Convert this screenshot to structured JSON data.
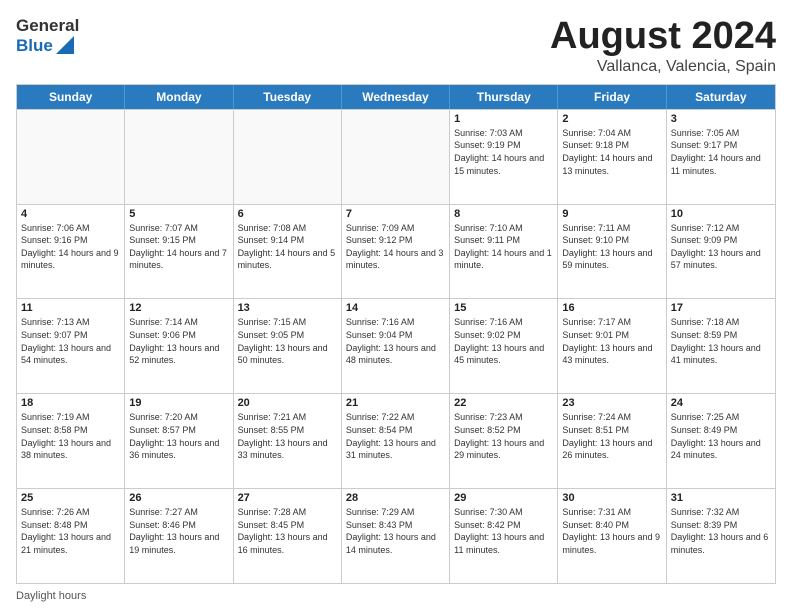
{
  "header": {
    "logo_general": "General",
    "logo_blue": "Blue",
    "title": "August 2024",
    "subtitle": "Vallanca, Valencia, Spain"
  },
  "days_of_week": [
    "Sunday",
    "Monday",
    "Tuesday",
    "Wednesday",
    "Thursday",
    "Friday",
    "Saturday"
  ],
  "footer_label": "Daylight hours",
  "weeks": [
    [
      {
        "day": "",
        "sunrise": "",
        "sunset": "",
        "daylight": ""
      },
      {
        "day": "",
        "sunrise": "",
        "sunset": "",
        "daylight": ""
      },
      {
        "day": "",
        "sunrise": "",
        "sunset": "",
        "daylight": ""
      },
      {
        "day": "",
        "sunrise": "",
        "sunset": "",
        "daylight": ""
      },
      {
        "day": "1",
        "sunrise": "Sunrise: 7:03 AM",
        "sunset": "Sunset: 9:19 PM",
        "daylight": "Daylight: 14 hours and 15 minutes."
      },
      {
        "day": "2",
        "sunrise": "Sunrise: 7:04 AM",
        "sunset": "Sunset: 9:18 PM",
        "daylight": "Daylight: 14 hours and 13 minutes."
      },
      {
        "day": "3",
        "sunrise": "Sunrise: 7:05 AM",
        "sunset": "Sunset: 9:17 PM",
        "daylight": "Daylight: 14 hours and 11 minutes."
      }
    ],
    [
      {
        "day": "4",
        "sunrise": "Sunrise: 7:06 AM",
        "sunset": "Sunset: 9:16 PM",
        "daylight": "Daylight: 14 hours and 9 minutes."
      },
      {
        "day": "5",
        "sunrise": "Sunrise: 7:07 AM",
        "sunset": "Sunset: 9:15 PM",
        "daylight": "Daylight: 14 hours and 7 minutes."
      },
      {
        "day": "6",
        "sunrise": "Sunrise: 7:08 AM",
        "sunset": "Sunset: 9:14 PM",
        "daylight": "Daylight: 14 hours and 5 minutes."
      },
      {
        "day": "7",
        "sunrise": "Sunrise: 7:09 AM",
        "sunset": "Sunset: 9:12 PM",
        "daylight": "Daylight: 14 hours and 3 minutes."
      },
      {
        "day": "8",
        "sunrise": "Sunrise: 7:10 AM",
        "sunset": "Sunset: 9:11 PM",
        "daylight": "Daylight: 14 hours and 1 minute."
      },
      {
        "day": "9",
        "sunrise": "Sunrise: 7:11 AM",
        "sunset": "Sunset: 9:10 PM",
        "daylight": "Daylight: 13 hours and 59 minutes."
      },
      {
        "day": "10",
        "sunrise": "Sunrise: 7:12 AM",
        "sunset": "Sunset: 9:09 PM",
        "daylight": "Daylight: 13 hours and 57 minutes."
      }
    ],
    [
      {
        "day": "11",
        "sunrise": "Sunrise: 7:13 AM",
        "sunset": "Sunset: 9:07 PM",
        "daylight": "Daylight: 13 hours and 54 minutes."
      },
      {
        "day": "12",
        "sunrise": "Sunrise: 7:14 AM",
        "sunset": "Sunset: 9:06 PM",
        "daylight": "Daylight: 13 hours and 52 minutes."
      },
      {
        "day": "13",
        "sunrise": "Sunrise: 7:15 AM",
        "sunset": "Sunset: 9:05 PM",
        "daylight": "Daylight: 13 hours and 50 minutes."
      },
      {
        "day": "14",
        "sunrise": "Sunrise: 7:16 AM",
        "sunset": "Sunset: 9:04 PM",
        "daylight": "Daylight: 13 hours and 48 minutes."
      },
      {
        "day": "15",
        "sunrise": "Sunrise: 7:16 AM",
        "sunset": "Sunset: 9:02 PM",
        "daylight": "Daylight: 13 hours and 45 minutes."
      },
      {
        "day": "16",
        "sunrise": "Sunrise: 7:17 AM",
        "sunset": "Sunset: 9:01 PM",
        "daylight": "Daylight: 13 hours and 43 minutes."
      },
      {
        "day": "17",
        "sunrise": "Sunrise: 7:18 AM",
        "sunset": "Sunset: 8:59 PM",
        "daylight": "Daylight: 13 hours and 41 minutes."
      }
    ],
    [
      {
        "day": "18",
        "sunrise": "Sunrise: 7:19 AM",
        "sunset": "Sunset: 8:58 PM",
        "daylight": "Daylight: 13 hours and 38 minutes."
      },
      {
        "day": "19",
        "sunrise": "Sunrise: 7:20 AM",
        "sunset": "Sunset: 8:57 PM",
        "daylight": "Daylight: 13 hours and 36 minutes."
      },
      {
        "day": "20",
        "sunrise": "Sunrise: 7:21 AM",
        "sunset": "Sunset: 8:55 PM",
        "daylight": "Daylight: 13 hours and 33 minutes."
      },
      {
        "day": "21",
        "sunrise": "Sunrise: 7:22 AM",
        "sunset": "Sunset: 8:54 PM",
        "daylight": "Daylight: 13 hours and 31 minutes."
      },
      {
        "day": "22",
        "sunrise": "Sunrise: 7:23 AM",
        "sunset": "Sunset: 8:52 PM",
        "daylight": "Daylight: 13 hours and 29 minutes."
      },
      {
        "day": "23",
        "sunrise": "Sunrise: 7:24 AM",
        "sunset": "Sunset: 8:51 PM",
        "daylight": "Daylight: 13 hours and 26 minutes."
      },
      {
        "day": "24",
        "sunrise": "Sunrise: 7:25 AM",
        "sunset": "Sunset: 8:49 PM",
        "daylight": "Daylight: 13 hours and 24 minutes."
      }
    ],
    [
      {
        "day": "25",
        "sunrise": "Sunrise: 7:26 AM",
        "sunset": "Sunset: 8:48 PM",
        "daylight": "Daylight: 13 hours and 21 minutes."
      },
      {
        "day": "26",
        "sunrise": "Sunrise: 7:27 AM",
        "sunset": "Sunset: 8:46 PM",
        "daylight": "Daylight: 13 hours and 19 minutes."
      },
      {
        "day": "27",
        "sunrise": "Sunrise: 7:28 AM",
        "sunset": "Sunset: 8:45 PM",
        "daylight": "Daylight: 13 hours and 16 minutes."
      },
      {
        "day": "28",
        "sunrise": "Sunrise: 7:29 AM",
        "sunset": "Sunset: 8:43 PM",
        "daylight": "Daylight: 13 hours and 14 minutes."
      },
      {
        "day": "29",
        "sunrise": "Sunrise: 7:30 AM",
        "sunset": "Sunset: 8:42 PM",
        "daylight": "Daylight: 13 hours and 11 minutes."
      },
      {
        "day": "30",
        "sunrise": "Sunrise: 7:31 AM",
        "sunset": "Sunset: 8:40 PM",
        "daylight": "Daylight: 13 hours and 9 minutes."
      },
      {
        "day": "31",
        "sunrise": "Sunrise: 7:32 AM",
        "sunset": "Sunset: 8:39 PM",
        "daylight": "Daylight: 13 hours and 6 minutes."
      }
    ]
  ]
}
